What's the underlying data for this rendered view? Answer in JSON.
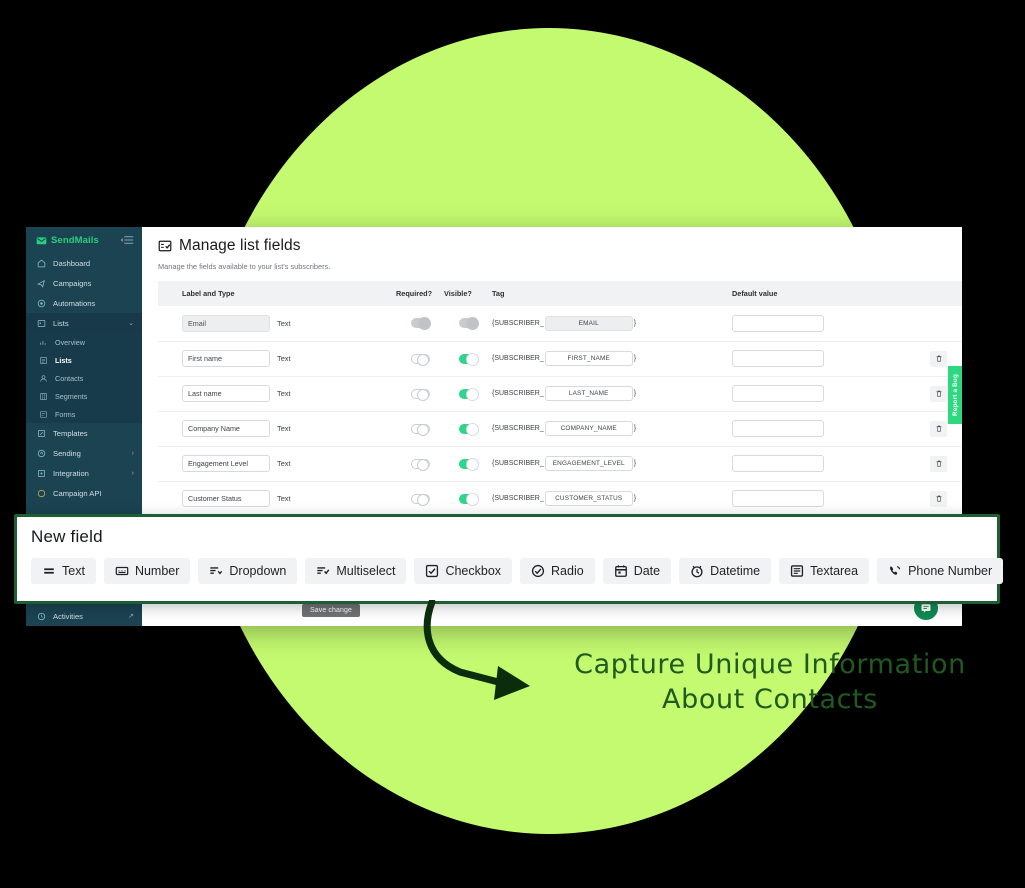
{
  "sidebar": {
    "brand": "SendMails",
    "brand_logo_icon": "envelope-logo-icon",
    "collapse_icon": "collapse-menu-icon",
    "items": [
      {
        "label": "Dashboard",
        "icon": "home-icon",
        "caret": ""
      },
      {
        "label": "Campaigns",
        "icon": "megaphone-icon",
        "caret": ""
      },
      {
        "label": "Automations",
        "icon": "automation-icon",
        "caret": ""
      },
      {
        "label": "Lists",
        "icon": "list-icon",
        "caret": "⌄"
      }
    ],
    "sub_items": [
      {
        "label": "Overview",
        "icon": "chart-bars-icon"
      },
      {
        "label": "Lists",
        "icon": "list-box-icon"
      },
      {
        "label": "Contacts",
        "icon": "person-icon"
      },
      {
        "label": "Segments",
        "icon": "segments-icon"
      },
      {
        "label": "Forms",
        "icon": "form-icon"
      }
    ],
    "items_after": [
      {
        "label": "Templates",
        "icon": "template-icon",
        "caret": ""
      },
      {
        "label": "Sending",
        "icon": "sending-icon",
        "caret": "›"
      },
      {
        "label": "Integration",
        "icon": "integration-icon",
        "caret": "›"
      },
      {
        "label": "Campaign API",
        "icon": "api-icon",
        "caret": ""
      }
    ],
    "bottom_items": [
      {
        "label": "Activities",
        "icon": "history-icon",
        "ext": "↗"
      }
    ]
  },
  "page": {
    "title": "Manage list fields",
    "title_icon": "form-checklist-icon",
    "subtitle": "Manage the fields available to your list's subscribers."
  },
  "table": {
    "headers": [
      "Label and Type",
      "Required?",
      "Visible?",
      "Tag",
      "Default value",
      ""
    ],
    "tag_prefix": "{SUBSCRIBER_",
    "tag_suffix": "}",
    "delete_icon": "trash-icon",
    "rows": [
      {
        "label": "Email",
        "type": "Text",
        "required": "dim",
        "visible": "dim",
        "tag": "EMAIL",
        "tag_locked": true,
        "default": "",
        "deletable": false
      },
      {
        "label": "First name",
        "type": "Text",
        "required": "off",
        "visible": "on",
        "tag": "FIRST_NAME",
        "tag_locked": false,
        "default": "",
        "deletable": true
      },
      {
        "label": "Last name",
        "type": "Text",
        "required": "off",
        "visible": "on",
        "tag": "LAST_NAME",
        "tag_locked": false,
        "default": "",
        "deletable": true
      },
      {
        "label": "Company Name",
        "type": "Text",
        "required": "off",
        "visible": "on",
        "tag": "COMPANY_NAME",
        "tag_locked": false,
        "default": "",
        "deletable": true
      },
      {
        "label": "Engagement Level",
        "type": "Text",
        "required": "off",
        "visible": "on",
        "tag": "ENGAGEMENT_LEVEL",
        "tag_locked": false,
        "default": "",
        "deletable": true
      },
      {
        "label": "Customer Status",
        "type": "Text",
        "required": "off",
        "visible": "on",
        "tag": "CUSTOMER_STATUS",
        "tag_locked": false,
        "default": "",
        "deletable": true
      }
    ]
  },
  "actions": {
    "save_label": "Save change",
    "chat_icon": "chat-bubble-icon",
    "report_bug_label": "Report a Bug"
  },
  "new_field": {
    "title": "New field",
    "types": [
      {
        "label": "Text",
        "icon": "text-lines-icon"
      },
      {
        "label": "Number",
        "icon": "number-box-icon"
      },
      {
        "label": "Dropdown",
        "icon": "dropdown-icon"
      },
      {
        "label": "Multiselect",
        "icon": "multiselect-icon"
      },
      {
        "label": "Checkbox",
        "icon": "checkbox-icon"
      },
      {
        "label": "Radio",
        "icon": "radio-check-icon"
      },
      {
        "label": "Date",
        "icon": "calendar-icon"
      },
      {
        "label": "Datetime",
        "icon": "clock-icon"
      },
      {
        "label": "Textarea",
        "icon": "textarea-icon"
      },
      {
        "label": "Phone Number",
        "icon": "phone-icon"
      }
    ]
  },
  "annotation": {
    "line1": "Capture Unique Information",
    "line2": "About Contacts",
    "arrow_icon": "curved-arrow-icon",
    "color": "#1f5a1f"
  },
  "theme": {
    "circle_green": "#c4fa70",
    "sidebar_bg": "#1b4352",
    "brand_green": "#26d07c",
    "toggle_on": "#2ed58b",
    "overlay_border": "#1c5f32",
    "background": "#000000"
  }
}
